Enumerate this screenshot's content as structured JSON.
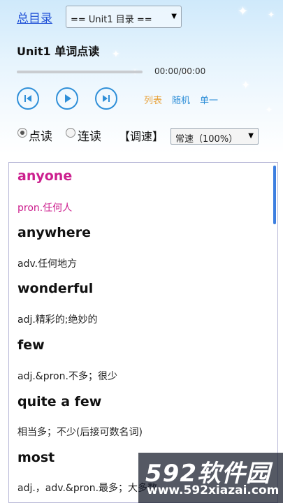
{
  "header": {
    "toc_link": "总目录",
    "unit_select": "== Unit1 目录 ==",
    "title": "Unit1 单词点读"
  },
  "player": {
    "time": "00:00/00:00",
    "progress": 0,
    "modes": {
      "list": "列表",
      "random": "随机",
      "single": "单一"
    }
  },
  "options": {
    "read_single": "点读",
    "read_continuous": "连读",
    "selected": "点读",
    "speed_label": "【调速】",
    "speed_value": "常速（100%）"
  },
  "words": [
    {
      "word": "anyone",
      "definition": "pron.任何人",
      "active": true
    },
    {
      "word": "anywhere",
      "definition": "adv.任何地方",
      "active": false
    },
    {
      "word": "wonderful",
      "definition": "adj.精彩的;绝妙的",
      "active": false
    },
    {
      "word": "few",
      "definition": "adj.&pron.不多；很少",
      "active": false
    },
    {
      "word": "quite a few",
      "definition": "相当多；不少(后接可数名词)",
      "active": false
    },
    {
      "word": "most",
      "definition": "adj.，adv.&pron.最多；大多数",
      "active": false
    }
  ],
  "colors": {
    "active": "#cc1f8e",
    "accent": "#2f8fd8",
    "list_mode": "#e8a23a"
  },
  "watermark": {
    "logo": "592软件园",
    "url": "www.592xiazai.com"
  }
}
